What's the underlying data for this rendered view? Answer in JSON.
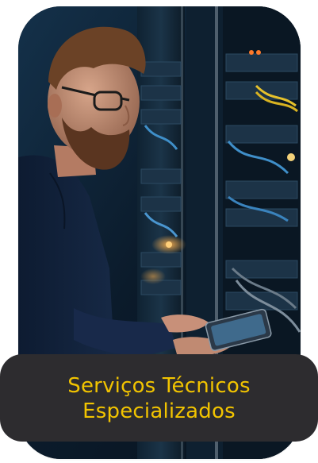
{
  "card": {
    "title": "Serviços Técnicos\nEspecializados",
    "image": "technician-in-server-room-photo"
  },
  "colors": {
    "label_background": "#2d2c2f",
    "label_text": "#f2c400",
    "card_background": "#0b1a2a"
  }
}
